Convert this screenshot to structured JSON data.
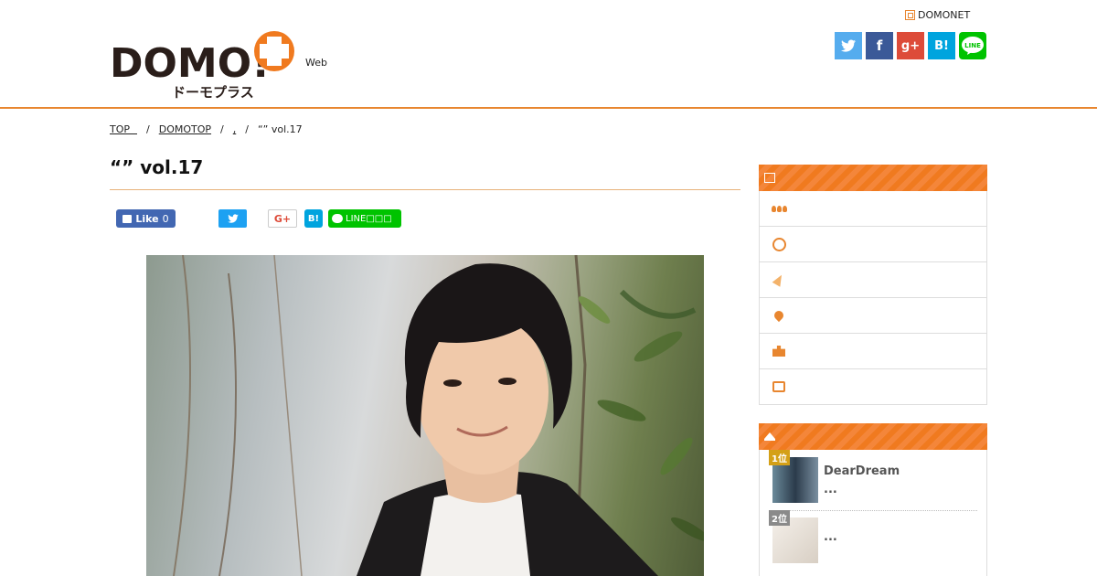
{
  "header": {
    "logo_main": "DOMO!",
    "logo_sub_jp": "ドーモプラス",
    "site_tag": "Web",
    "domonet_label": "DOMONET",
    "social": [
      "twitter",
      "facebook",
      "google-plus",
      "hatena",
      "line"
    ],
    "social_labels": {
      "hatena": "B!",
      "line": "LINE",
      "google": "g+",
      "facebook": "f"
    }
  },
  "breadcrumb": [
    "TOP",
    "DOMOTOP",
    ",",
    "“” vol.17"
  ],
  "article": {
    "title": "“” vol.17"
  },
  "share": {
    "fb_like": "Like",
    "fb_count": "0",
    "gplus": "G+",
    "hatena": "B!",
    "line": "LINE□□□"
  },
  "sidebar": {
    "menu_icons": [
      "people-icon",
      "clock-icon",
      "party-icon",
      "map-pin-icon",
      "building-icon",
      "books-icon"
    ],
    "ranking": [
      {
        "rank": "1位",
        "title": "DearDream",
        "sub": "...",
        "badge_color": "#d4a017"
      },
      {
        "rank": "2位",
        "title": "",
        "sub": "...",
        "badge_color": "#8a8a8a"
      }
    ]
  },
  "colors": {
    "accent": "#e8862f",
    "twitter": "#55acee",
    "facebook": "#3b5998",
    "gplus": "#dd4b39",
    "hatena": "#00a4de",
    "line": "#00c300"
  }
}
